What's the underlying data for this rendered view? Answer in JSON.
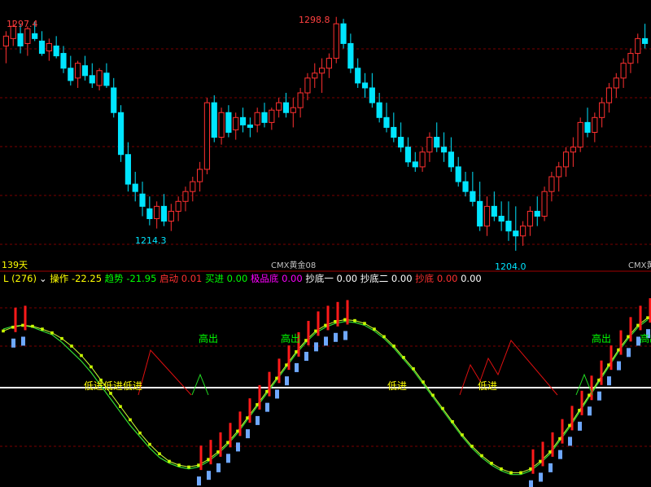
{
  "chart_data": [
    {
      "type": "candlestick",
      "title": "CMX黄金08",
      "period_label": "139天",
      "y_range": [
        1200,
        1303
      ],
      "price_labels": {
        "high1": "1297.4",
        "high2": "1298.8",
        "low1": "1214.3",
        "low2": "1204.0"
      },
      "right_label": "CMX黄",
      "grid": true,
      "candles": [
        [
          1287,
          1293,
          1280,
          1291
        ],
        [
          1290,
          1297.4,
          1287,
          1295
        ],
        [
          1292,
          1296,
          1284,
          1287
        ],
        [
          1288,
          1295,
          1283,
          1294
        ],
        [
          1292,
          1297,
          1289,
          1290
        ],
        [
          1289,
          1293,
          1283,
          1284
        ],
        [
          1285,
          1290,
          1281,
          1288
        ],
        [
          1287,
          1291,
          1282,
          1283
        ],
        [
          1284,
          1287,
          1276,
          1278
        ],
        [
          1278,
          1283,
          1271,
          1273
        ],
        [
          1274,
          1281,
          1270,
          1280
        ],
        [
          1279,
          1283,
          1273,
          1275
        ],
        [
          1275,
          1280,
          1270,
          1272
        ],
        [
          1271,
          1278,
          1269,
          1277
        ],
        [
          1276,
          1280,
          1270,
          1271
        ],
        [
          1270,
          1274,
          1258,
          1260
        ],
        [
          1260,
          1263,
          1240,
          1243
        ],
        [
          1243,
          1248,
          1228,
          1231
        ],
        [
          1231,
          1236,
          1224,
          1228
        ],
        [
          1227,
          1232,
          1218,
          1222
        ],
        [
          1221,
          1226,
          1214.3,
          1217
        ],
        [
          1217,
          1224,
          1213,
          1222
        ],
        [
          1222,
          1227,
          1214,
          1216
        ],
        [
          1216,
          1223,
          1212,
          1220
        ],
        [
          1220,
          1226,
          1216,
          1224
        ],
        [
          1224,
          1230,
          1220,
          1228
        ],
        [
          1228,
          1234,
          1224,
          1232
        ],
        [
          1232,
          1240,
          1228,
          1237
        ],
        [
          1237,
          1266,
          1235,
          1264
        ],
        [
          1264,
          1267,
          1248,
          1250
        ],
        [
          1250,
          1262,
          1247,
          1260
        ],
        [
          1260,
          1263,
          1250,
          1252
        ],
        [
          1253,
          1260,
          1249,
          1258
        ],
        [
          1258,
          1262,
          1252,
          1255
        ],
        [
          1255,
          1258,
          1250,
          1254
        ],
        [
          1255,
          1262,
          1252,
          1260
        ],
        [
          1260,
          1264,
          1254,
          1256
        ],
        [
          1256,
          1262,
          1253,
          1261
        ],
        [
          1261,
          1266,
          1258,
          1264
        ],
        [
          1264,
          1268,
          1258,
          1260
        ],
        [
          1260,
          1266,
          1254,
          1262
        ],
        [
          1262,
          1270,
          1258,
          1268
        ],
        [
          1268,
          1276,
          1265,
          1274
        ],
        [
          1274,
          1280,
          1270,
          1276
        ],
        [
          1276,
          1282,
          1268,
          1278
        ],
        [
          1278,
          1284,
          1274,
          1282
        ],
        [
          1282,
          1298.8,
          1280,
          1296
        ],
        [
          1296,
          1298,
          1286,
          1288
        ],
        [
          1288,
          1292,
          1276,
          1278
        ],
        [
          1278,
          1282,
          1270,
          1272
        ],
        [
          1272,
          1276,
          1266,
          1270
        ],
        [
          1270,
          1276,
          1262,
          1264
        ],
        [
          1264,
          1268,
          1256,
          1258
        ],
        [
          1258,
          1264,
          1252,
          1254
        ],
        [
          1254,
          1260,
          1248,
          1250
        ],
        [
          1250,
          1256,
          1244,
          1246
        ],
        [
          1246,
          1250,
          1238,
          1240
        ],
        [
          1240,
          1244,
          1236,
          1238
        ],
        [
          1238,
          1246,
          1236,
          1244
        ],
        [
          1244,
          1252,
          1240,
          1250
        ],
        [
          1250,
          1256,
          1244,
          1246
        ],
        [
          1246,
          1252,
          1240,
          1244
        ],
        [
          1244,
          1250,
          1236,
          1238
        ],
        [
          1238,
          1242,
          1230,
          1232
        ],
        [
          1232,
          1236,
          1226,
          1228
        ],
        [
          1228,
          1236,
          1222,
          1224
        ],
        [
          1224,
          1232,
          1212,
          1214
        ],
        [
          1214,
          1226,
          1210,
          1222
        ],
        [
          1222,
          1228,
          1216,
          1218
        ],
        [
          1218,
          1224,
          1212,
          1216
        ],
        [
          1216,
          1224,
          1208,
          1212
        ],
        [
          1212,
          1222,
          1204.0,
          1210
        ],
        [
          1210,
          1216,
          1206,
          1214
        ],
        [
          1214,
          1222,
          1210,
          1220
        ],
        [
          1220,
          1226,
          1214,
          1218
        ],
        [
          1218,
          1230,
          1216,
          1228
        ],
        [
          1228,
          1236,
          1224,
          1234
        ],
        [
          1234,
          1240,
          1228,
          1238
        ],
        [
          1238,
          1246,
          1234,
          1244
        ],
        [
          1244,
          1250,
          1238,
          1246
        ],
        [
          1246,
          1258,
          1244,
          1256
        ],
        [
          1256,
          1262,
          1250,
          1252
        ],
        [
          1252,
          1260,
          1248,
          1258
        ],
        [
          1258,
          1266,
          1254,
          1264
        ],
        [
          1264,
          1272,
          1260,
          1270
        ],
        [
          1270,
          1276,
          1266,
          1274
        ],
        [
          1274,
          1282,
          1270,
          1280
        ],
        [
          1280,
          1286,
          1276,
          1284
        ],
        [
          1284,
          1292,
          1280,
          1290
        ],
        [
          1290,
          1296,
          1286,
          1288
        ]
      ]
    },
    {
      "type": "indicator",
      "header": {
        "name": "L (276)",
        "items": [
          {
            "label": "操作",
            "value": "-22.25",
            "color": "#ffff00"
          },
          {
            "label": "趋势",
            "value": "-21.95",
            "color": "#00ff00"
          },
          {
            "label": "启动",
            "value": "0.01",
            "color": "#ff3030"
          },
          {
            "label": "买进",
            "value": "0.00",
            "color": "#00ff00"
          },
          {
            "label": "极品底",
            "value": "0.00",
            "color": "#ff00ff"
          },
          {
            "label": "抄底一",
            "value": "0.00",
            "color": "#ffffff"
          },
          {
            "label": "抄底二",
            "value": "0.00",
            "color": "#ffffff"
          },
          {
            "label": "抄底",
            "value": "0.00",
            "color": "#ff3030"
          },
          {
            "label": "",
            "value": "0.00",
            "color": "#ffffff"
          }
        ]
      },
      "annotations": [
        {
          "text": "高出",
          "color": "#00ff00"
        },
        {
          "text": "高出",
          "color": "#00ff00"
        },
        {
          "text": "高出",
          "color": "#00ff00"
        },
        {
          "text": "高出",
          "color": "#00ff00"
        },
        {
          "text": "低进低进低进",
          "color": "#ffff00"
        },
        {
          "text": "低进",
          "color": "#ffff00"
        },
        {
          "text": "低进",
          "color": "#ffff00"
        }
      ],
      "y_range": [
        -100,
        100
      ],
      "baseline": 0,
      "series": [
        {
          "values": [
            60,
            64,
            66,
            65,
            62,
            58,
            52,
            44,
            34,
            22,
            8,
            -6,
            -20,
            -34,
            -48,
            -60,
            -70,
            -78,
            -82,
            -84,
            -82,
            -76,
            -68,
            -58,
            -46,
            -32,
            -18,
            -4,
            10,
            24,
            38,
            50,
            60,
            66,
            70,
            72,
            71,
            68,
            62,
            54,
            44,
            32,
            20,
            6,
            -8,
            -22,
            -36,
            -50,
            -62,
            -72,
            -80,
            -86,
            -90,
            -90,
            -86,
            -78,
            -68,
            -54,
            -40,
            -24,
            -8,
            8,
            24,
            40,
            54,
            66,
            74
          ]
        },
        {
          "values": [
            62,
            65,
            66,
            64,
            60,
            56,
            48,
            38,
            28,
            16,
            2,
            -12,
            -26,
            -40,
            -52,
            -64,
            -74,
            -80,
            -84,
            -86,
            -84,
            -78,
            -70,
            -60,
            -48,
            -34,
            -20,
            -6,
            8,
            22,
            36,
            48,
            58,
            64,
            68,
            70,
            69,
            66,
            60,
            52,
            42,
            30,
            18,
            4,
            -10,
            -24,
            -38,
            -52,
            -64,
            -74,
            -82,
            -88,
            -92,
            -92,
            -88,
            -80,
            -70,
            -56,
            -42,
            -26,
            -10,
            6,
            22,
            38,
            52,
            64,
            72
          ]
        }
      ]
    }
  ]
}
